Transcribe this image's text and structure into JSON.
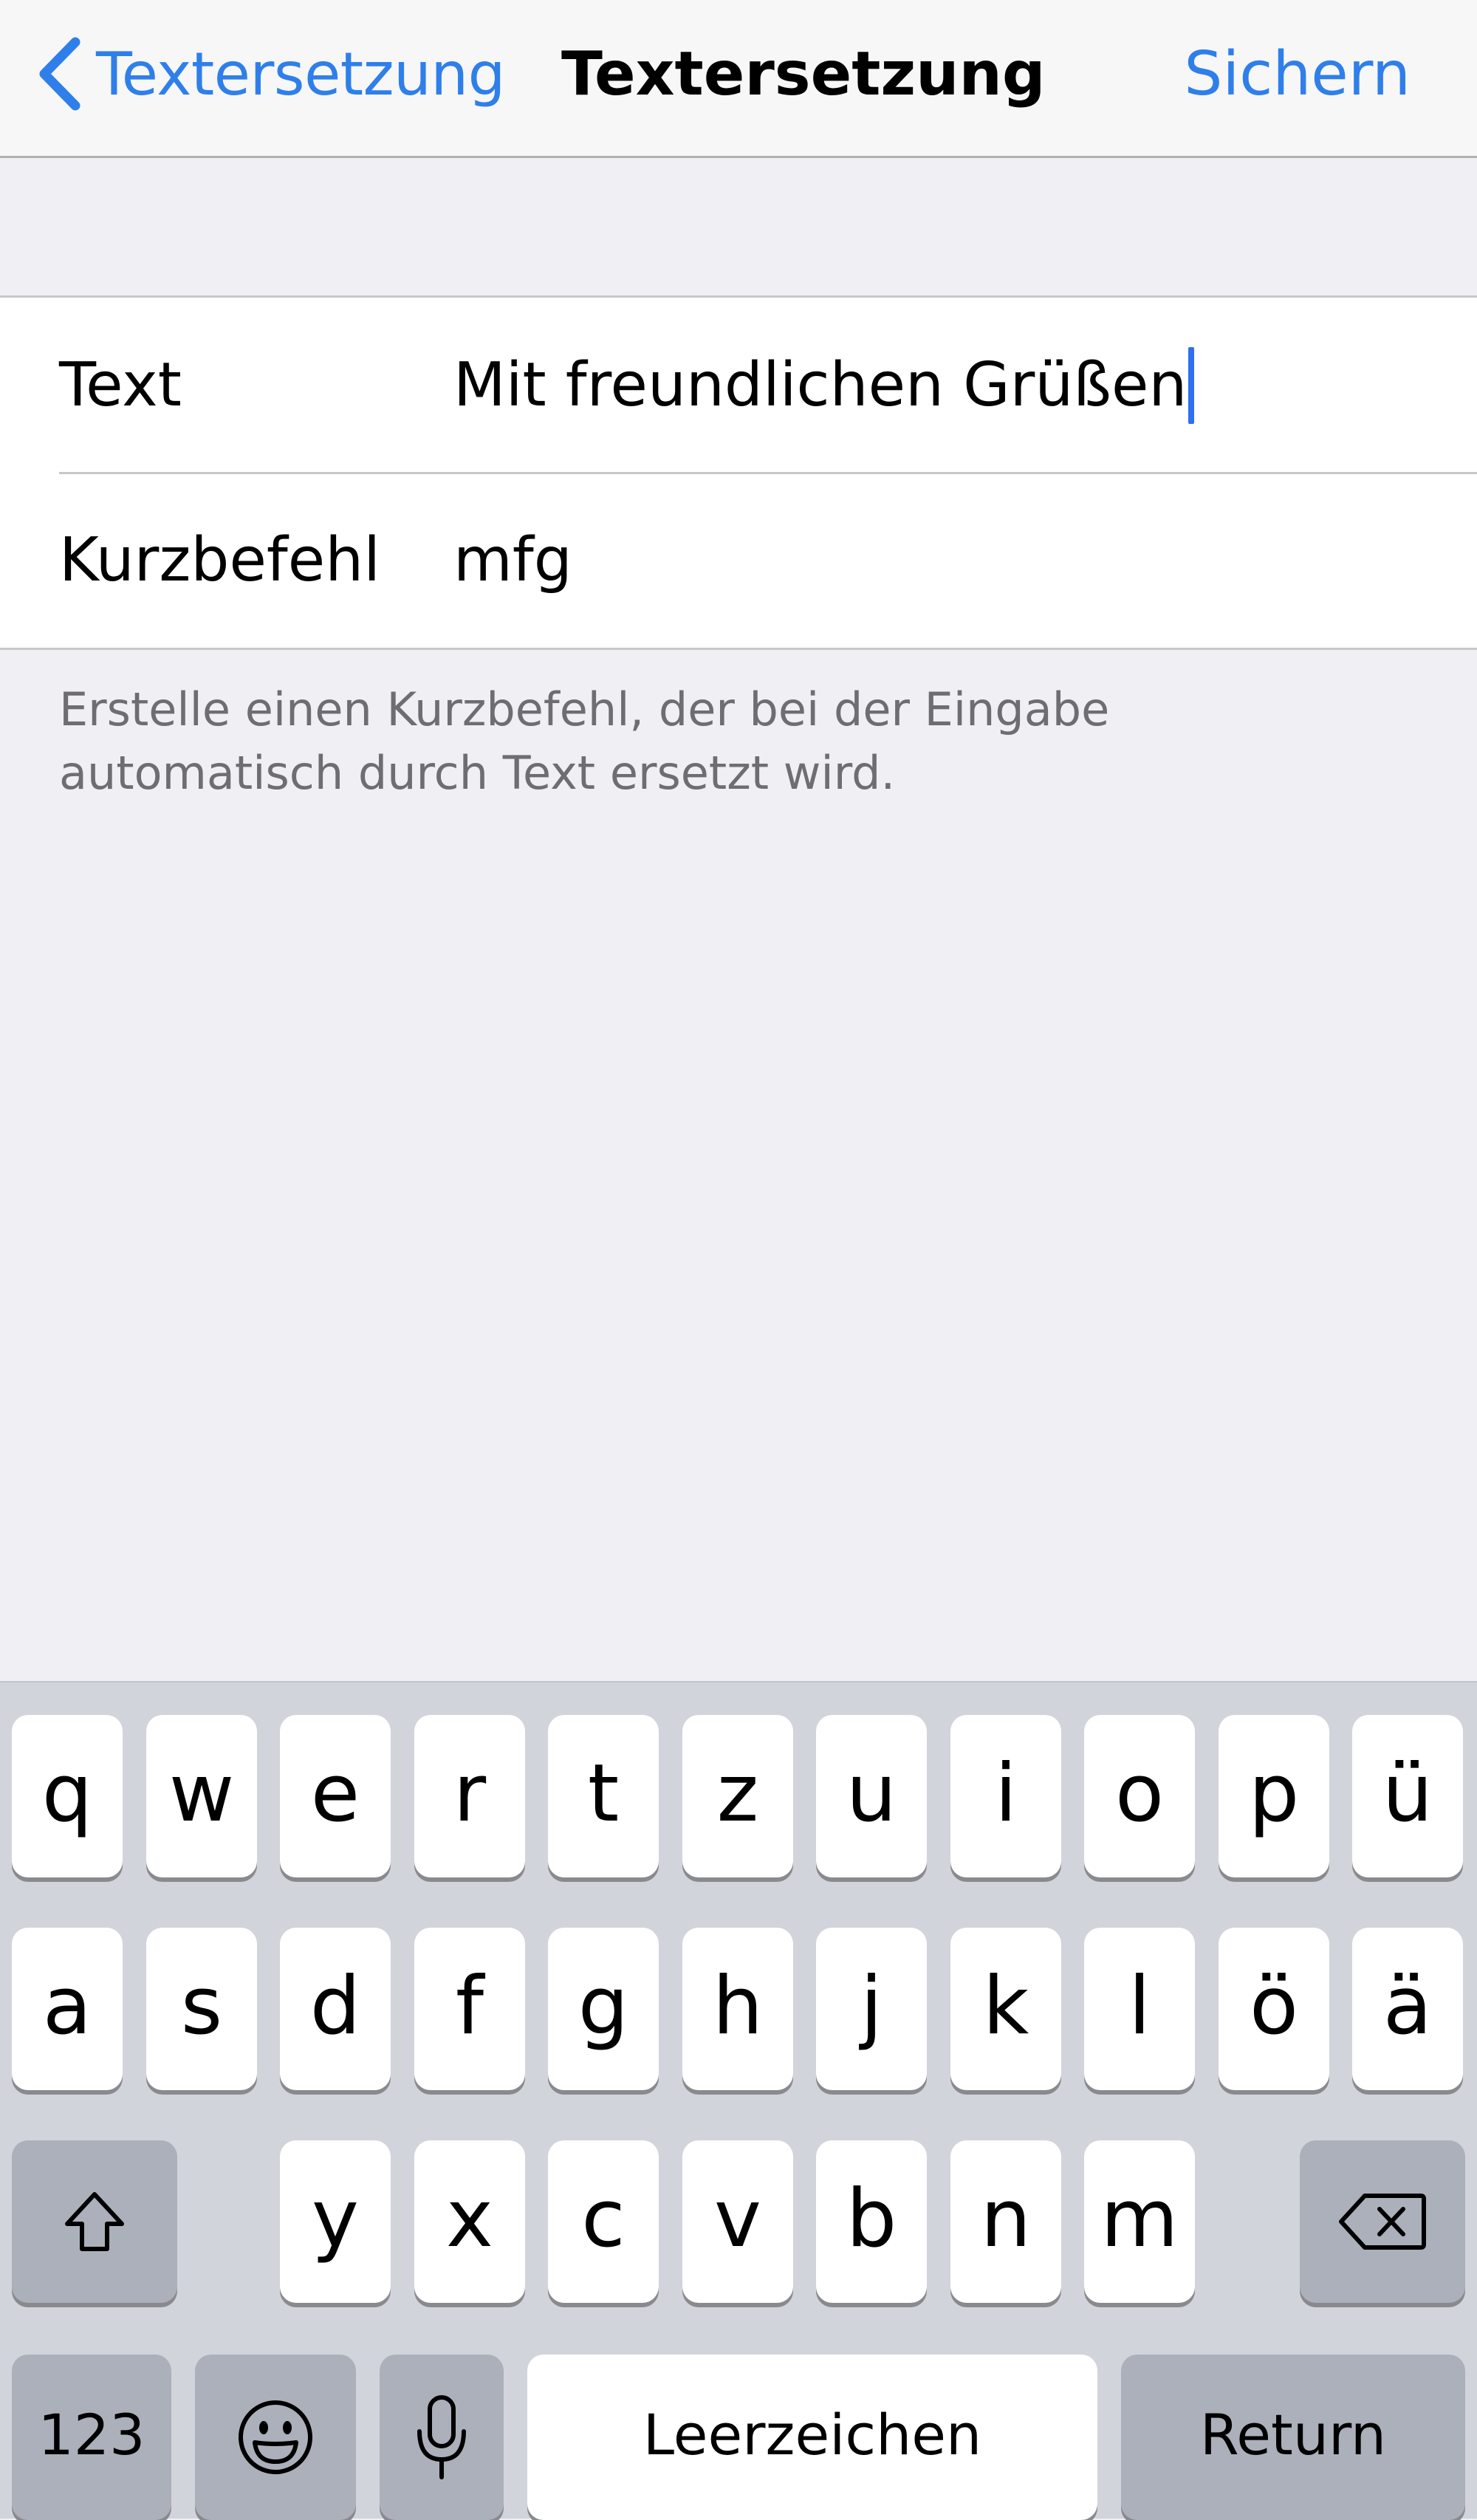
{
  "nav": {
    "back_label": "Textersetzung",
    "title": "Textersetzung",
    "save_label": "Sichern"
  },
  "form": {
    "rows": [
      {
        "label": "Text",
        "value": "Mit freundlichen Grüßen"
      },
      {
        "label": "Kurzbefehl",
        "value": "mfg"
      }
    ],
    "footer": "Erstelle einen Kurzbefehl, der bei der Eingabe automatisch durch Text ersetzt wird."
  },
  "keyboard": {
    "row1": [
      "q",
      "w",
      "e",
      "r",
      "t",
      "z",
      "u",
      "i",
      "o",
      "p",
      "ü"
    ],
    "row2": [
      "a",
      "s",
      "d",
      "f",
      "g",
      "h",
      "j",
      "k",
      "l",
      "ö",
      "ä"
    ],
    "row3": [
      "y",
      "x",
      "c",
      "v",
      "b",
      "n",
      "m"
    ],
    "numbers_label": "123",
    "space_label": "Leerzeichen",
    "return_label": "Return",
    "icons": {
      "shift": "shift-icon",
      "delete": "delete-icon",
      "emoji": "emoji-icon",
      "mic": "microphone-icon"
    }
  },
  "colors": {
    "accent": "#2f7fea",
    "caret": "#2f6ff0",
    "background": "#efeff4",
    "keyboard_bg": "#d1d4da",
    "key_dark": "#abb0ba"
  }
}
